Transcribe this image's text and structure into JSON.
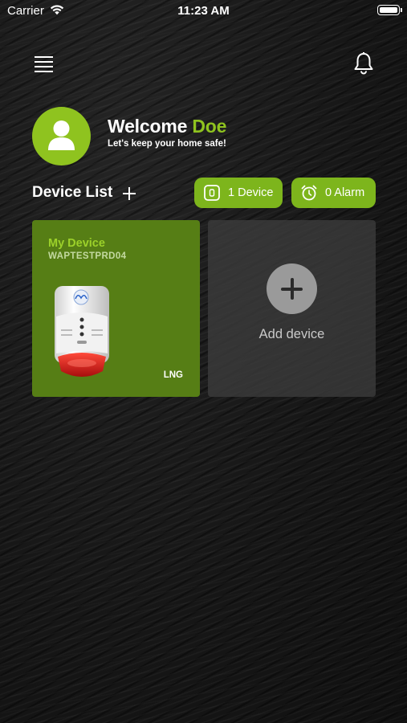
{
  "status_bar": {
    "carrier": "Carrier",
    "time": "11:23 AM"
  },
  "header": {
    "menu_icon": "hamburger-menu-icon",
    "notification_icon": "bell-icon"
  },
  "profile": {
    "avatar_icon": "user-avatar-icon",
    "welcome_prefix": "Welcome",
    "user_name": "Doe",
    "tagline": "Let's keep your home safe!"
  },
  "device_list": {
    "title": "Device List",
    "add_icon": "plus-icon",
    "device_count_label": "1 Device",
    "alarm_count_label": "0 Alarm"
  },
  "devices": [
    {
      "name": "My Device",
      "serial": "WAPTESTPRD04",
      "gas_type": "LNG"
    }
  ],
  "add_device_label": "Add device",
  "colors": {
    "accent": "#8fc31f",
    "pill": "#7db51c",
    "device_card": "#567e15",
    "add_card": "#3c3c3c",
    "background": "#151515"
  }
}
